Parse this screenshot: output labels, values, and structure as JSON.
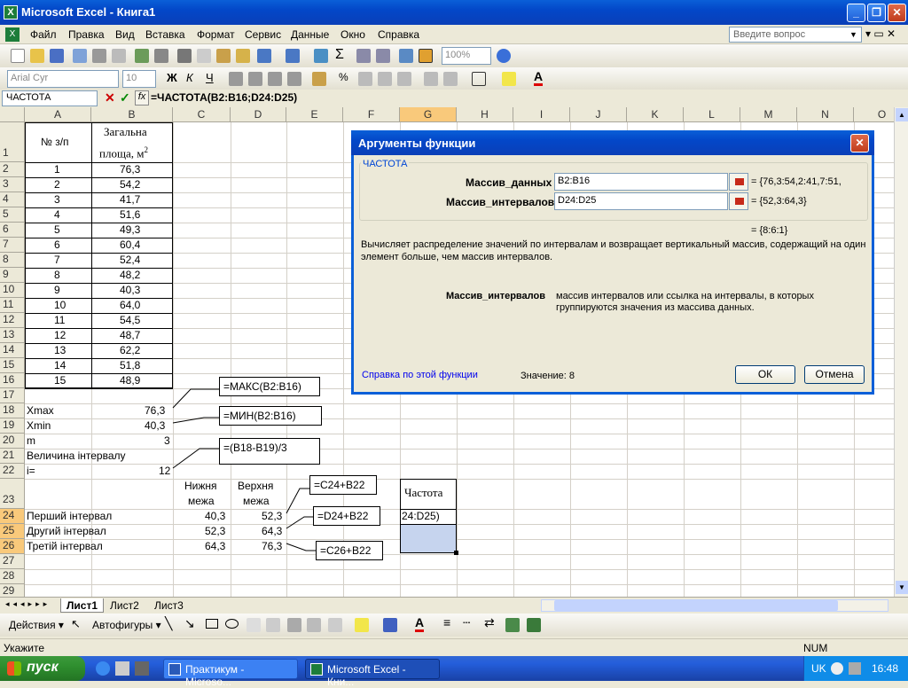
{
  "window": {
    "title": "Microsoft Excel - Книга1"
  },
  "menu": {
    "items": [
      "Файл",
      "Правка",
      "Вид",
      "Вставка",
      "Формат",
      "Сервис",
      "Данные",
      "Окно",
      "Справка"
    ],
    "ask_placeholder": "Введите вопрос"
  },
  "toolbar": {
    "zoom": "100%",
    "font": "Arial Cyr",
    "size": "10"
  },
  "formula_bar": {
    "name_box": "ЧАСТОТА",
    "formula": "=ЧАСТОТА(B2:B16;D24:D25)"
  },
  "columns": [
    "A",
    "B",
    "C",
    "D",
    "E",
    "F",
    "G",
    "H",
    "I",
    "J",
    "K",
    "L",
    "M",
    "N",
    "O"
  ],
  "rows": [
    "1",
    "2",
    "3",
    "4",
    "5",
    "6",
    "7",
    "8",
    "9",
    "10",
    "11",
    "12",
    "13",
    "14",
    "15",
    "16",
    "17",
    "18",
    "19",
    "20",
    "21",
    "22",
    "23",
    "24",
    "25",
    "26",
    "27",
    "28",
    "29"
  ],
  "sheet": {
    "a1": "№ з/п",
    "b1_line1": "Загальна",
    "b1_line2": "площа, м",
    "b1_sup": "2",
    "numbers": [
      "1",
      "2",
      "3",
      "4",
      "5",
      "6",
      "7",
      "8",
      "9",
      "10",
      "11",
      "12",
      "13",
      "14",
      "15"
    ],
    "areas": [
      "76,3",
      "54,2",
      "41,7",
      "51,6",
      "49,3",
      "60,4",
      "52,4",
      "48,2",
      "40,3",
      "64,0",
      "54,5",
      "48,7",
      "62,2",
      "51,8",
      "48,9"
    ],
    "xmax_label": "Xmax",
    "xmax": "76,3",
    "xmin_label": "Xmin",
    "xmin": "40,3",
    "m_label": "m",
    "m": "3",
    "interval_label": "Величина інтервалу",
    "i_label": "i=",
    "i": "12",
    "lower_line1": "Нижня",
    "lower_line2": "межа",
    "upper_line1": "Верхня",
    "upper_line2": "межа",
    "freq_header": "Частота",
    "int1": "Перший інтервал",
    "int1_low": "40,3",
    "int1_high": "52,3",
    "int2": "Другий інтервал",
    "int2_low": "52,3",
    "int2_high": "64,3",
    "int3": "Третій інтервал",
    "int3_low": "64,3",
    "int3_high": "76,3",
    "g24": "24:D25)",
    "callout_max": "=МАКС(B2:B16)",
    "callout_min": "=МИН(B2:B16)",
    "callout_i": "=(B18-B19)/3",
    "callout_c24": "=C24+B22",
    "callout_d24": "=D24+B22",
    "callout_c26": "=C26+B22"
  },
  "sheet_tabs": [
    "Лист1",
    "Лист2",
    "Лист3"
  ],
  "drawing_toolbar": {
    "actions": "Действия",
    "autoshapes": "Автофигуры"
  },
  "status": {
    "mode": "Укажите",
    "num": "NUM"
  },
  "dialog": {
    "title": "Аргументы функции",
    "group": "ЧАСТОТА",
    "arg1_label": "Массив_данных",
    "arg1_value": "B2:B16",
    "arg1_result": "= {76,3:54,2:41,7:51,",
    "arg2_label": "Массив_интервалов",
    "arg2_value": "D24:D25",
    "arg2_result": "= {52,3:64,3}",
    "total_result": "= {8:6:1}",
    "description": "Вычисляет распределение значений по интервалам и возвращает вертикальный массив, содержащий на один элемент больше, чем массив интервалов.",
    "help_arg_label": "Массив_интервалов",
    "help_arg_text": "массив интервалов или ссылка на интервалы, в которых группируются значения из массива данных.",
    "help_link": "Справка по этой функции",
    "value_label": "Значение:",
    "value": "8",
    "ok": "ОК",
    "cancel": "Отмена"
  },
  "taskbar": {
    "start": "пуск",
    "tasks": [
      "Практикум - Microso...",
      "Microsoft Excel - Кни..."
    ],
    "lang": "UK",
    "time": "16:48"
  }
}
